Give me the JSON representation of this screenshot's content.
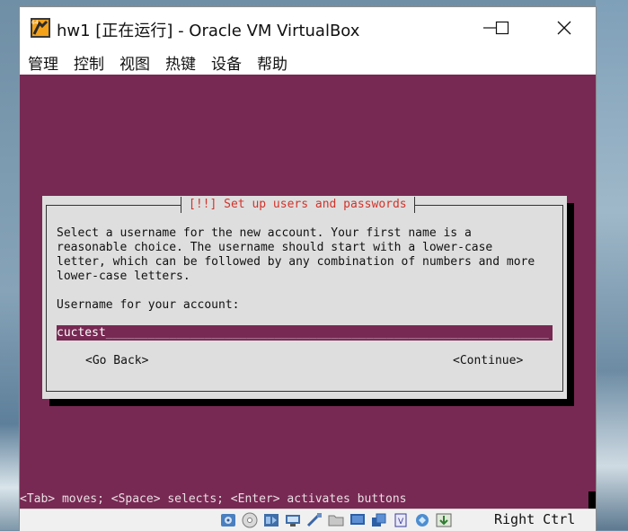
{
  "window": {
    "title": "hw1 [正在运行] - Oracle VM VirtualBox",
    "menu": [
      "管理",
      "控制",
      "视图",
      "热键",
      "设备",
      "帮助"
    ]
  },
  "installer": {
    "dialog_title": "[!!] Set up users and passwords",
    "description": "Select a username for the new account. Your first name is a\nreasonable choice. The username should start with a lower-case\nletter, which can be followed by any combination of numbers and more\nlower-case letters.",
    "username_label": "Username for your account:",
    "username_value": "cuctest",
    "username_fill": "_______________________________________________________________",
    "go_back": "<Go Back>",
    "continue": "<Continue>",
    "status_line": "<Tab> moves; <Space> selects; <Enter> activates buttons"
  },
  "statusbar": {
    "host_key": "Right Ctrl",
    "icons": [
      "hard-disk-icon",
      "optical-drive-icon",
      "audio-icon",
      "network-icon",
      "usb-icon",
      "shared-folders-icon",
      "display-icon",
      "video-capture-icon",
      "cpu-icon",
      "mouse-integration-icon",
      "keyboard-capture-icon"
    ]
  },
  "colors": {
    "guest_bg": "#772953",
    "dialog_bg": "#dedede",
    "dialog_title": "#d3332a"
  }
}
